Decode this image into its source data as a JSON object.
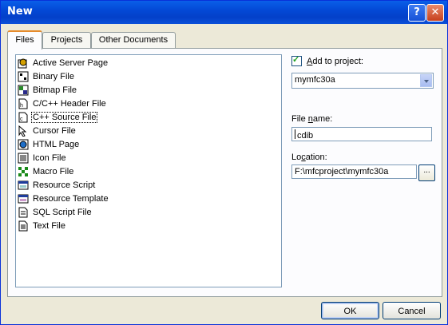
{
  "window": {
    "title": "New",
    "help_glyph": "?",
    "close_glyph": "✕"
  },
  "tabs": [
    {
      "label": "Files",
      "active": true
    },
    {
      "label": "Projects",
      "active": false
    },
    {
      "label": "Other Documents",
      "active": false
    }
  ],
  "files": [
    {
      "label": "Active Server Page",
      "icon": "asp-icon"
    },
    {
      "label": "Binary File",
      "icon": "binary-file-icon"
    },
    {
      "label": "Bitmap File",
      "icon": "bitmap-file-icon"
    },
    {
      "label": "C/C++ Header File",
      "icon": "header-file-icon"
    },
    {
      "label": "C++ Source File",
      "icon": "cpp-source-icon",
      "selected": true
    },
    {
      "label": "Cursor File",
      "icon": "cursor-file-icon"
    },
    {
      "label": "HTML Page",
      "icon": "html-page-icon"
    },
    {
      "label": "Icon File",
      "icon": "icon-file-icon"
    },
    {
      "label": "Macro File",
      "icon": "macro-file-icon"
    },
    {
      "label": "Resource Script",
      "icon": "resource-script-icon"
    },
    {
      "label": "Resource Template",
      "icon": "resource-template-icon"
    },
    {
      "label": "SQL Script File",
      "icon": "sql-script-icon"
    },
    {
      "label": "Text File",
      "icon": "text-file-icon"
    }
  ],
  "add_to_project": {
    "checked": true,
    "label_pre": "",
    "label_accel": "A",
    "label_post": "dd to project:",
    "project": "mymfc30a"
  },
  "file_name": {
    "label_pre": "File ",
    "label_accel": "n",
    "label_post": "ame:",
    "value": "cdib"
  },
  "location": {
    "label_pre": "Lo",
    "label_accel": "c",
    "label_post": "ation:",
    "value": "F:\\mfcproject\\mymfc30a",
    "browse_label": "..."
  },
  "buttons": {
    "ok": "OK",
    "cancel": "Cancel"
  }
}
